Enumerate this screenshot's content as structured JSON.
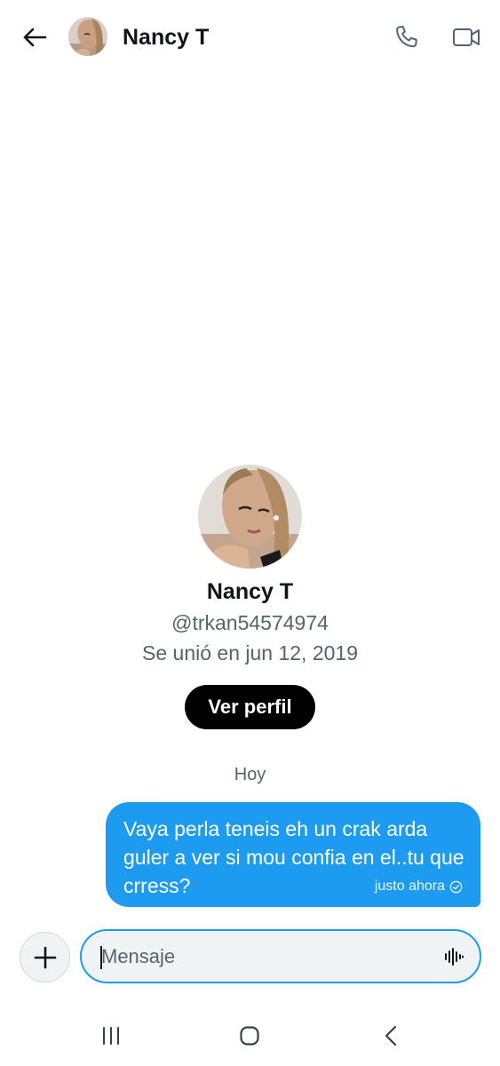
{
  "header": {
    "contact_name": "Nancy T",
    "back_icon": "arrow-left-icon",
    "call_icon": "phone-icon",
    "video_icon": "video-camera-icon"
  },
  "profile": {
    "name": "Nancy T",
    "handle": "@trkan54574974",
    "joined": "Se unió en jun 12, 2019",
    "view_profile_label": "Ver perfil"
  },
  "conversation": {
    "date_separator": "Hoy",
    "messages": [
      {
        "text": "Vaya perla teneis eh un crak arda guler a ver si mou confia en el..tu que crress?",
        "time": "justo ahora",
        "status_icon": "sent-check-icon",
        "direction": "outgoing"
      }
    ]
  },
  "composer": {
    "placeholder": "Mensaje",
    "value": "",
    "add_icon": "plus-icon",
    "voice_icon": "voice-wave-icon"
  },
  "system_nav": {
    "recents_icon": "recents-icon",
    "home_icon": "home-icon",
    "back_icon": "back-chevron-icon"
  },
  "colors": {
    "accent": "#1d9bf0",
    "text_primary": "#0f1419",
    "text_secondary": "#536471",
    "button_dark": "#000000",
    "composer_bg": "#eff3f4"
  }
}
